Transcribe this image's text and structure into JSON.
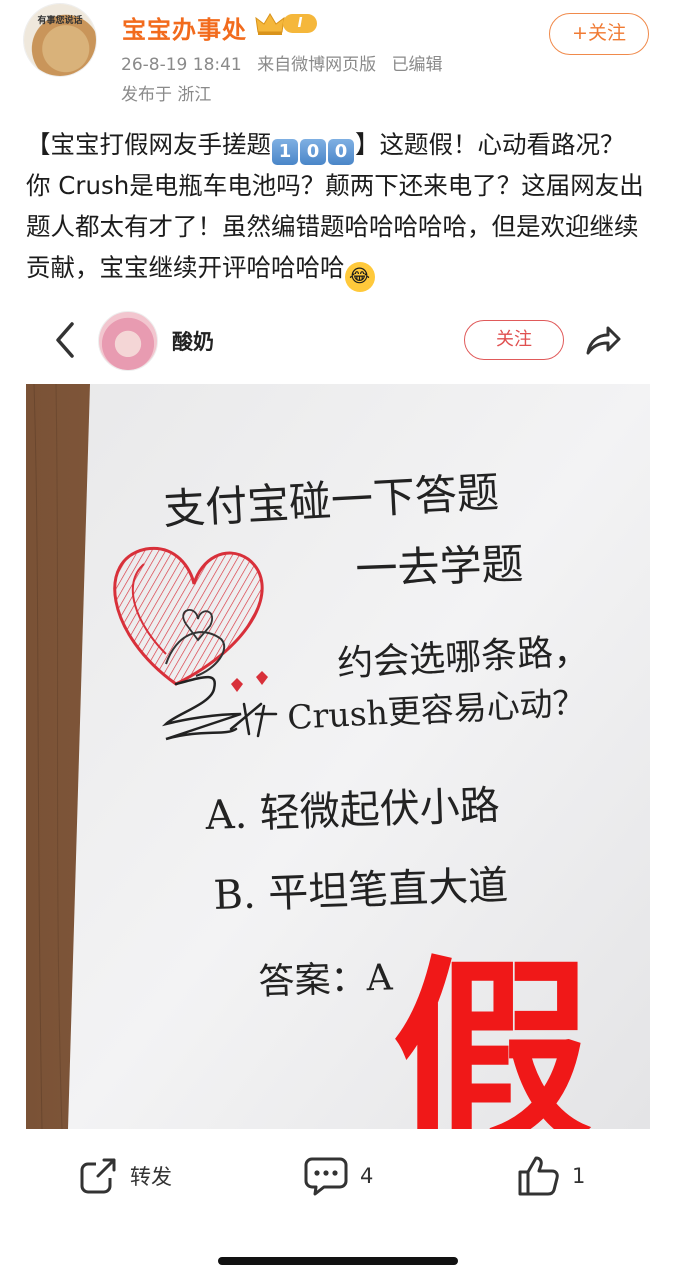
{
  "header": {
    "avatar_caption": "有事您说话",
    "username": "宝宝办事处",
    "badge_level": "I",
    "date": "26-8-19 18:41",
    "source": "来自微博网页版",
    "edited": "已编辑",
    "location": "发布于 浙江",
    "follow_label": "+关注"
  },
  "post": {
    "part1": "【宝宝打假网友手搓题",
    "keycaps": [
      "1",
      "0",
      "0"
    ],
    "part2": "】这题假！心动看路况？你 Crush是电瓶车电池吗？颠两下还来电了？这届网友出题人都太有才了！虽然编错题哈哈哈哈哈，但是欢迎继续贡献，宝宝继续开评哈哈哈哈"
  },
  "embed": {
    "username": "酸奶",
    "follow_label": "关注",
    "back_icon": "chevron-left-icon",
    "share_icon": "share-icon"
  },
  "photo": {
    "line1": "支付宝碰一下答题",
    "line2": "一去学题",
    "line3": "约会选哪条路，",
    "line4": "Crush更容易心动？",
    "option_a": "A. 轻微起伏小路",
    "option_b": "B. 平坦笔直大道",
    "answer": "答案：A",
    "stamp": "假"
  },
  "actions": {
    "repost_label": "转发",
    "comment_count": "4",
    "like_count": "1"
  },
  "colors": {
    "brand_orange": "#f26b1d",
    "stamp_red": "#f01818",
    "heart_red": "#d8303a"
  }
}
